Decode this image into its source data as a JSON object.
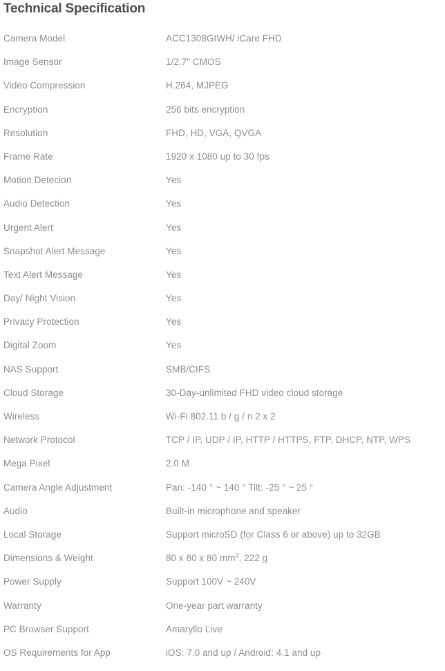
{
  "document": {
    "title": "Technical Specification",
    "text_color": "#8e8e90",
    "title_color": "#4d4d4f",
    "background_color": "#ffffff"
  },
  "spec_table": {
    "rows": [
      {
        "label": "Camera Model",
        "value": "ACC1308GIWH/ iCare FHD"
      },
      {
        "label": "Image Sensor",
        "value": "1/2.7\" CMOS"
      },
      {
        "label": "Video Compression",
        "value": "H.264, MJPEG"
      },
      {
        "label": "Encryption",
        "value": "256 bits encryption"
      },
      {
        "label": "Resolution",
        "value": "FHD, HD, VGA, QVGA"
      },
      {
        "label": "Frame Rate",
        "value": "1920 x 1080 up to 30 fps"
      },
      {
        "label": "Motion Detecion",
        "value": "Yes"
      },
      {
        "label": "Audio Detection",
        "value": "Yes"
      },
      {
        "label": "Urgent Alert",
        "value": "Yes"
      },
      {
        "label": "Snapshot Alert Message",
        "value": "Yes"
      },
      {
        "label": "Text Alert Message",
        "value": "Yes"
      },
      {
        "label": "Day/ Night Vision",
        "value": "Yes"
      },
      {
        "label": "Privacy Protection",
        "value": "Yes"
      },
      {
        "label": "Digital Zoom",
        "value": "Yes"
      },
      {
        "label": "NAS Support",
        "value": "SMB/CIFS"
      },
      {
        "label": "Cloud Storage",
        "value": "30-Day-unlimited FHD video cloud storage"
      },
      {
        "label": "Wireless",
        "value": "Wi-Fi 802.11 b / g / n  2 x 2"
      },
      {
        "label": "Network Protocol",
        "value": "TCP / IP, UDP / IP, HTTP / HTTPS, FTP, DHCP, NTP, WPS"
      },
      {
        "label": "Mega Pixel",
        "value": "2.0 M"
      },
      {
        "label": "Camera Angle Adjustment",
        "value": "Pan: -140 ° ~ 140 °      Tilt: -25 ° ~ 25 °"
      },
      {
        "label": "Audio",
        "value": "Built-in microphone and speaker"
      },
      {
        "label": "Local Storage",
        "value": "Support microSD (for Class 6 or above) up to 32GB"
      },
      {
        "label": "Dimensions & Weight",
        "value": "80 x 80 x 80 mm³, 222 g"
      },
      {
        "label": "Power Supply",
        "value": "Support 100V ~ 240V"
      },
      {
        "label": "Warranty",
        "value": "One-year part warranty"
      },
      {
        "label": "PC Browser Support",
        "value": "Amaryllo Live"
      },
      {
        "label": "OS Requirements for App",
        "value": "iOS: 7.0 and up / Android: 4.1 and up"
      }
    ]
  }
}
